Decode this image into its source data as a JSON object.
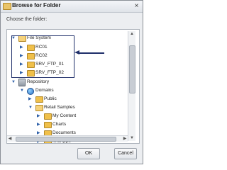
{
  "dialog": {
    "title": "Browse for Folder",
    "prompt": "Choose the folder:",
    "close_symbol": "×",
    "buttons": {
      "ok": "OK",
      "cancel": "Cancel"
    }
  },
  "tree": [
    {
      "label": "File System",
      "icon": "folder-open-icon",
      "expanded": true
    },
    {
      "label": "RC01",
      "icon": "folder-icon",
      "expanded": false
    },
    {
      "label": "RC02",
      "icon": "folder-icon",
      "expanded": false
    },
    {
      "label": "SRV_FTP_01",
      "icon": "folder-icon",
      "expanded": false
    },
    {
      "label": "SRV_FTP_02",
      "icon": "folder-icon",
      "expanded": false
    },
    {
      "label": "Repository",
      "icon": "repository-icon",
      "expanded": true
    },
    {
      "label": "Domains",
      "icon": "globe-icon",
      "expanded": true
    },
    {
      "label": "Public",
      "icon": "folder-icon",
      "expanded": false
    },
    {
      "label": "Retail Samples",
      "icon": "folder-open-icon",
      "expanded": true
    },
    {
      "label": "My Content",
      "icon": "folder-icon",
      "expanded": false
    },
    {
      "label": "Charts",
      "icon": "folder-icon",
      "expanded": false
    },
    {
      "label": "Documents",
      "icon": "folder-icon",
      "expanded": false
    },
    {
      "label": "InfoApps",
      "icon": "folder-icon",
      "expanded": false
    }
  ],
  "colors": {
    "highlight": "#1f2f6a",
    "folder": "#f0c04a"
  }
}
